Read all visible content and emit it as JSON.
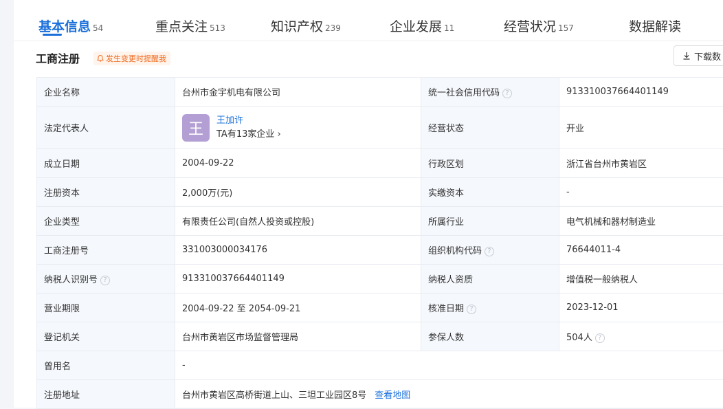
{
  "tabs": [
    {
      "label": "基本信息",
      "count": "54"
    },
    {
      "label": "重点关注",
      "count": "513"
    },
    {
      "label": "知识产权",
      "count": "239"
    },
    {
      "label": "企业发展",
      "count": "11"
    },
    {
      "label": "经营状况",
      "count": "157"
    },
    {
      "label": "数据解读",
      "count": ""
    }
  ],
  "section": {
    "title": "工商注册",
    "remind_label": "发生变更时提醒我",
    "download_label": "下载数"
  },
  "colors": {
    "accent": "#1a6fdb",
    "remind": "#f06a1e",
    "avatar": "#b39fd4"
  },
  "rows": {
    "r1": {
      "k1": "企业名称",
      "v1": "台州市金宇机电有限公司",
      "k2": "统一社会信用代码",
      "v2": "913310037664401149"
    },
    "r2": {
      "k1": "法定代表人",
      "avatar_char": "王",
      "rep_name": "王加许",
      "rep_sub": "TA有13家企业",
      "k2": "经营状态",
      "v2": "开业"
    },
    "r3": {
      "k1": "成立日期",
      "v1": "2004-09-22",
      "k2": "行政区划",
      "v2": "浙江省台州市黄岩区"
    },
    "r4": {
      "k1": "注册资本",
      "v1": "2,000万(元)",
      "k2": "实缴资本",
      "v2": "-"
    },
    "r5": {
      "k1": "企业类型",
      "v1": "有限责任公司(自然人投资或控股)",
      "k2": "所属行业",
      "v2": "电气机械和器材制造业"
    },
    "r6": {
      "k1": "工商注册号",
      "v1": "331003000034176",
      "k2": "组织机构代码",
      "v2": "76644011-4"
    },
    "r7": {
      "k1": "纳税人识别号",
      "v1": "913310037664401149",
      "k2": "纳税人资质",
      "v2": "增值税一般纳税人"
    },
    "r8": {
      "k1": "营业期限",
      "v1": "2004-09-22 至 2054-09-21",
      "k2": "核准日期",
      "v2": "2023-12-01"
    },
    "r9": {
      "k1": "登记机关",
      "v1": "台州市黄岩区市场监督管理局",
      "k2": "参保人数",
      "v2": "504人"
    },
    "r10": {
      "k1": "曾用名",
      "v1": "-"
    },
    "r11": {
      "k1": "注册地址",
      "v1": "台州市黄岩区高桥街道上山、三坦工业园区8号",
      "link": "查看地图"
    }
  }
}
